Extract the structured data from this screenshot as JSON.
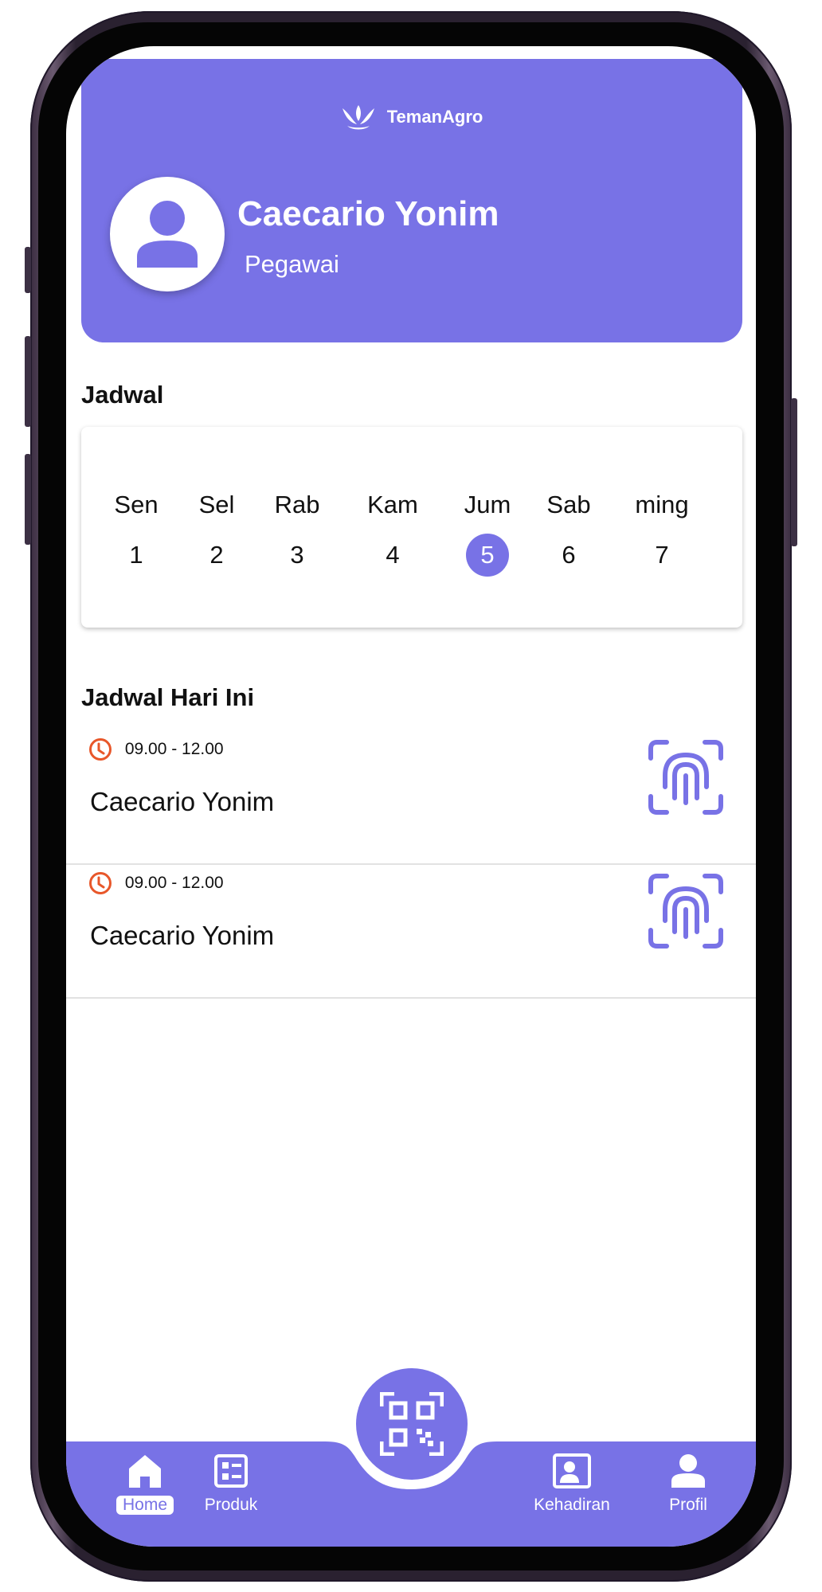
{
  "app": {
    "brand": "TemanAgro"
  },
  "profile": {
    "name": "Caecario Yonim",
    "role": "Pegawai"
  },
  "schedule": {
    "title": "Jadwal",
    "days": [
      {
        "name": "Sen",
        "num": "1"
      },
      {
        "name": "Sel",
        "num": "2"
      },
      {
        "name": "Rab",
        "num": "3"
      },
      {
        "name": "Kam",
        "num": "4"
      },
      {
        "name": "Jum",
        "num": "5",
        "active": true
      },
      {
        "name": "Sab",
        "num": "6"
      },
      {
        "name": "ming",
        "num": "7"
      }
    ]
  },
  "today": {
    "title": "Jadwal Hari Ini",
    "entries": [
      {
        "time": "09.00 - 12.00",
        "name": "Caecario Yonim"
      },
      {
        "time": "09.00 - 12.00",
        "name": "Caecario Yonim"
      }
    ]
  },
  "nav": {
    "items": [
      {
        "label": "Home",
        "icon": "home-icon",
        "active": true
      },
      {
        "label": "Produk",
        "icon": "product-icon"
      },
      {
        "label": "Kehadiran",
        "icon": "attendance-icon"
      },
      {
        "label": "Profil",
        "icon": "profile-icon"
      }
    ],
    "center_icon": "qr-code-icon"
  },
  "colors": {
    "primary": "#7872e6",
    "clock": "#e8572a",
    "white": "#ffffff"
  }
}
